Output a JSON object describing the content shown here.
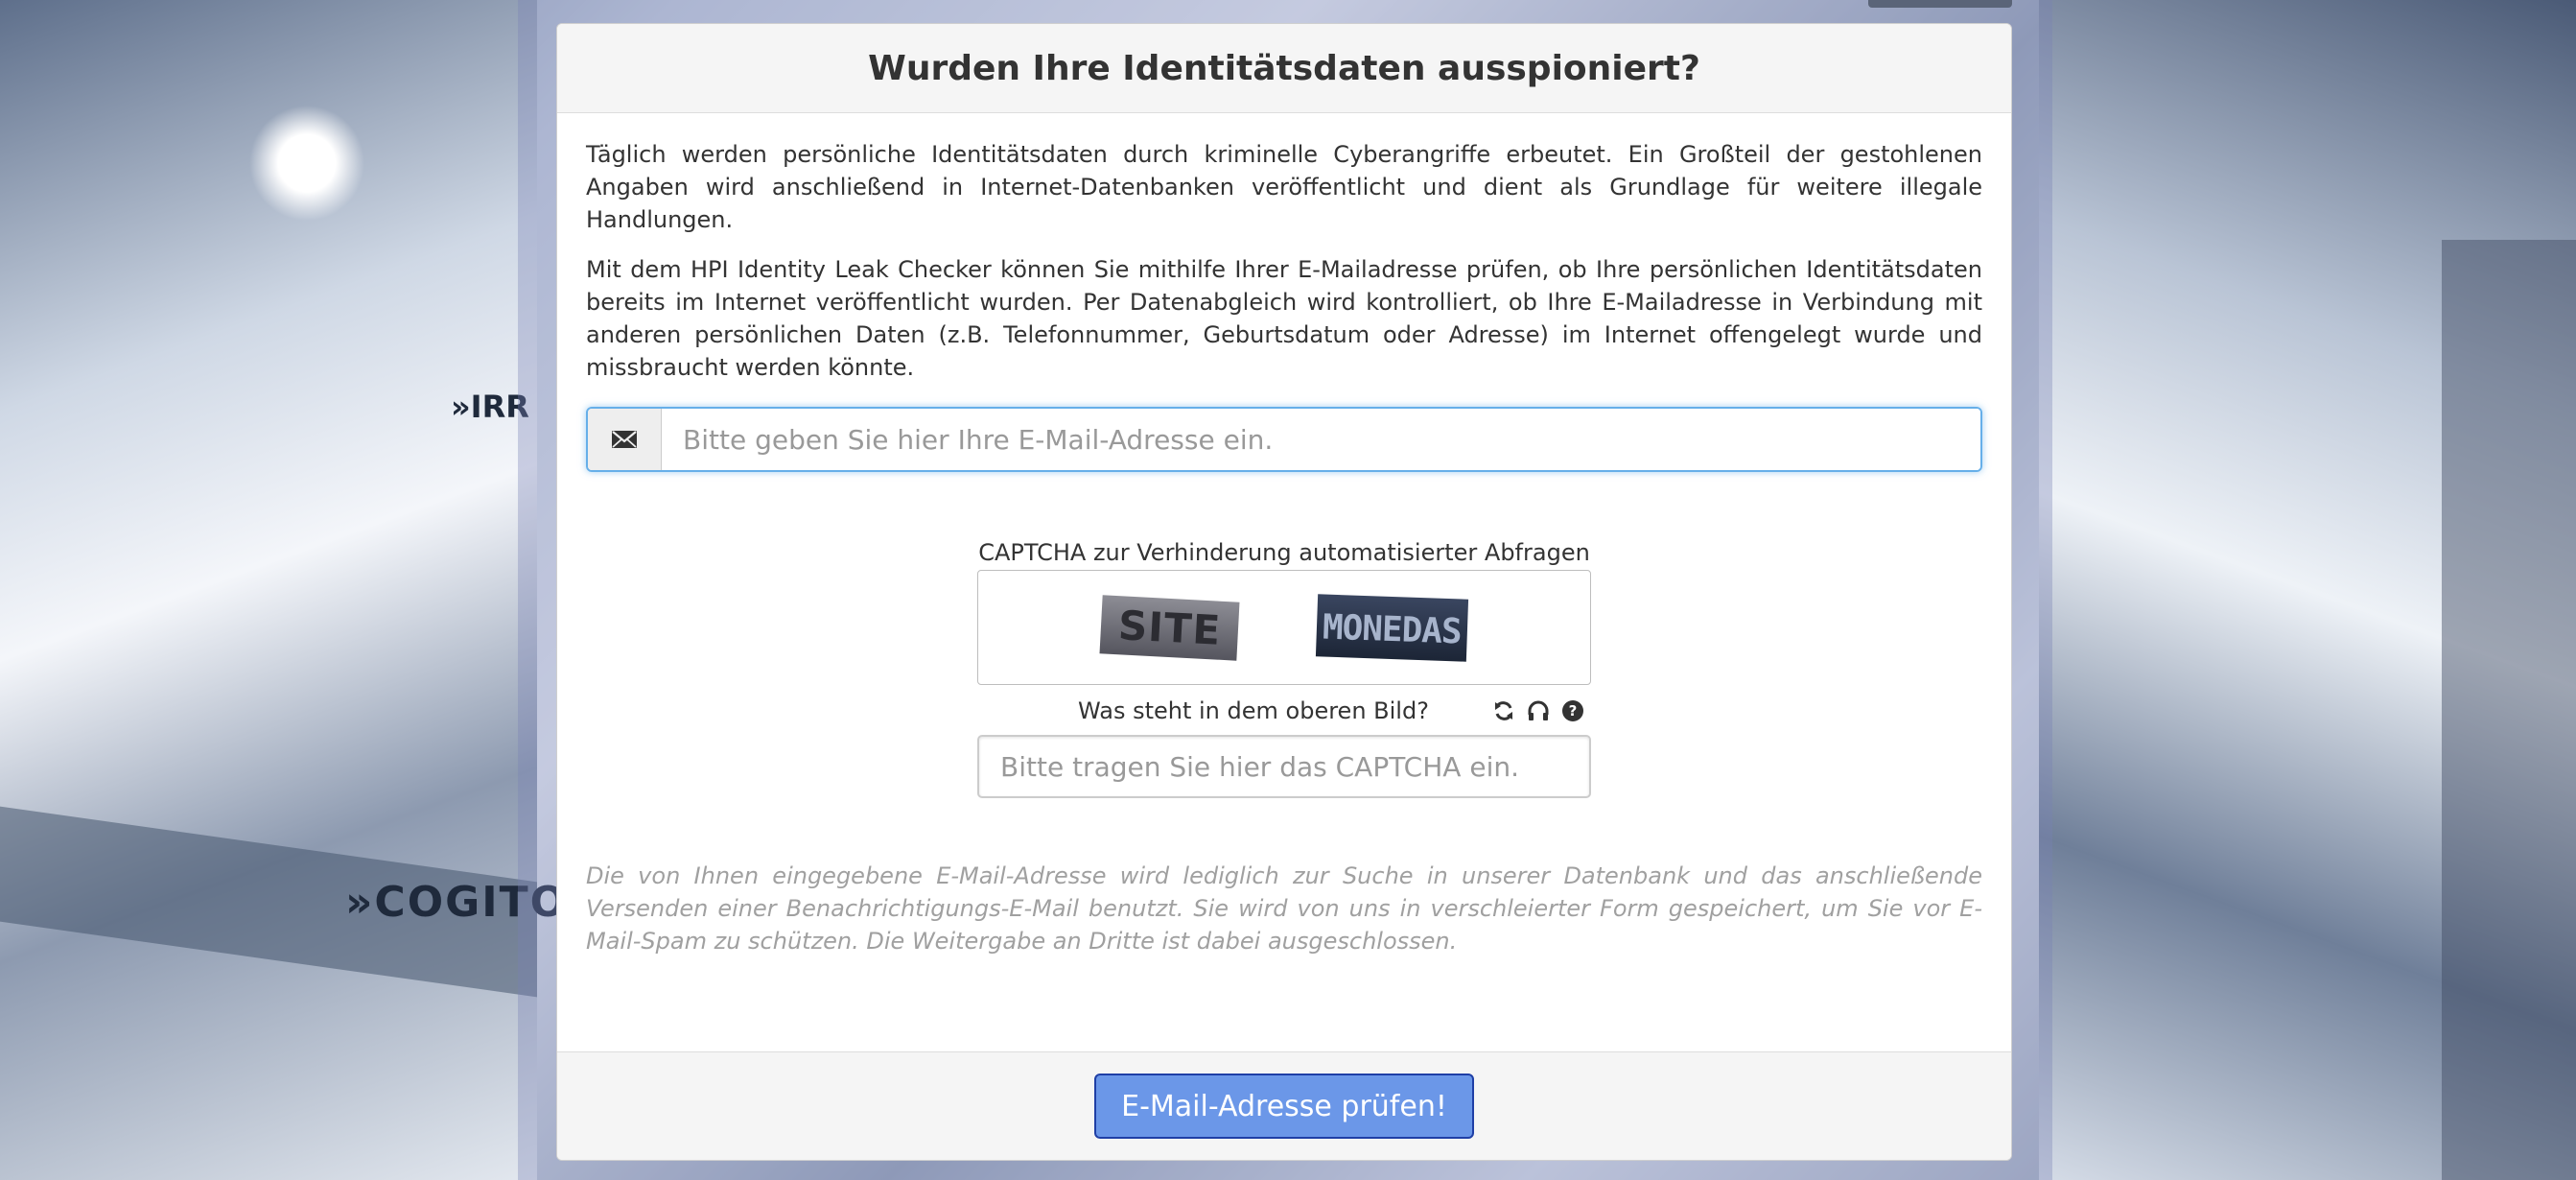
{
  "header": {
    "title": "Wurden Ihre Identitätsdaten ausspioniert?"
  },
  "intro": {
    "paragraph1": "Täglich werden persönliche Identitätsdaten durch kriminelle Cyberangriffe erbeutet. Ein Großteil der gestohlenen Angaben wird anschließend in Internet-Datenbanken veröffentlicht und dient als Grundlage für weitere illegale Handlungen.",
    "paragraph2": "Mit dem HPI Identity Leak Checker können Sie mithilfe Ihrer E-Mailadresse prüfen, ob Ihre persönlichen Identitätsdaten bereits im Internet veröffentlicht wurden. Per Datenabgleich wird kontrolliert, ob Ihre E-Mailadresse in Verbindung mit anderen persönlichen Daten (z.B. Telefonnummer, Geburtsdatum oder Adresse) im Internet offengelegt wurde und missbraucht werden könnte."
  },
  "email": {
    "icon": "envelope-icon",
    "value": "",
    "placeholder": "Bitte geben Sie hier Ihre E-Mail-Adresse ein."
  },
  "captcha": {
    "label": "CAPTCHA zur Verhinderung automatisierter Abfragen",
    "word1": "SITE",
    "word2": "MONEDAS",
    "question": "Was steht in dem oberen Bild?",
    "tools": [
      "refresh-icon",
      "headphones-icon",
      "help-icon"
    ],
    "value": "",
    "placeholder": "Bitte tragen Sie hier das CAPTCHA ein."
  },
  "disclaimer": "Die von Ihnen eingegebene E-Mail-Adresse wird lediglich zur Suche in unserer Datenbank und das anschließende Versenden einer Benachrichtigungs-E-Mail benutzt. Sie wird von uns in verschleierter Form gespeichert, um Sie vor E-Mail-Spam zu schützen. Die Weitergabe an Dritte ist dabei ausgeschlossen.",
  "footer": {
    "submit_label": "E-Mail-Adresse prüfen!"
  },
  "background": {
    "text_left": "»COGITO",
    "text_left_top": "»IRR"
  },
  "colors": {
    "accent": "#6b97e8",
    "focus": "#66afe9",
    "header_bg": "#f5f5f5"
  }
}
